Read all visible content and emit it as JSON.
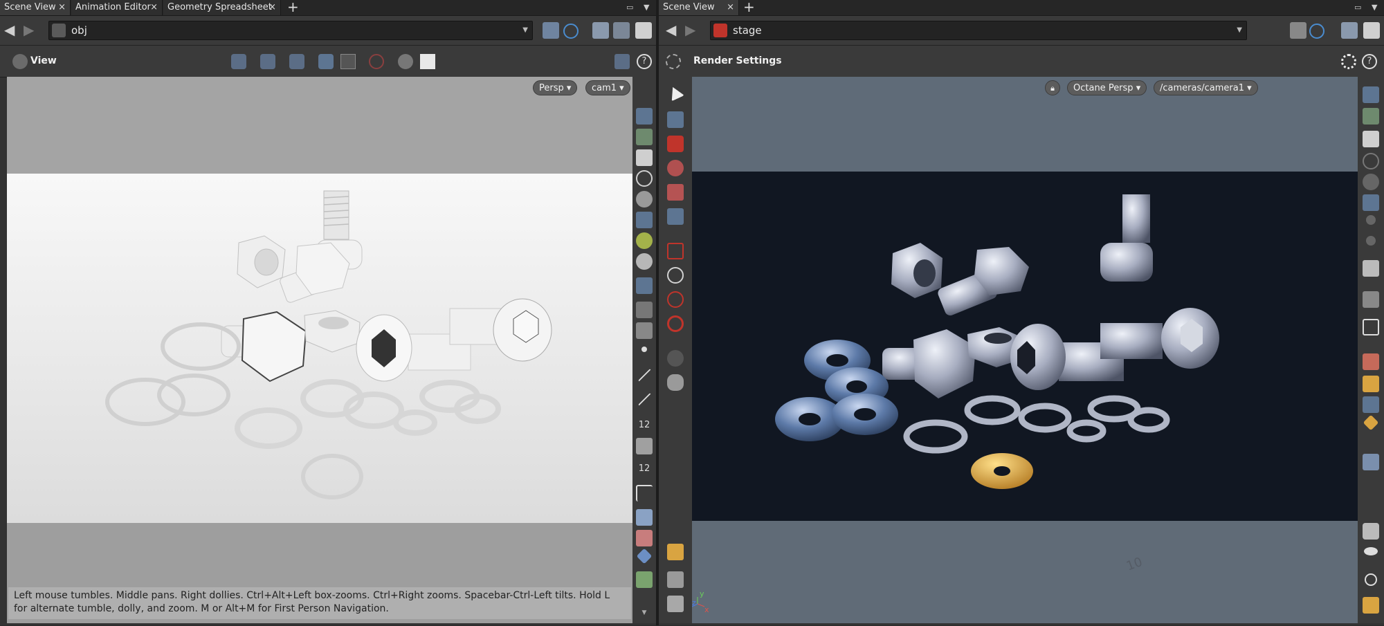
{
  "left_pane": {
    "tabs": [
      {
        "label": "Scene View",
        "close": "×"
      },
      {
        "label": "Animation Editor",
        "close": "×"
      },
      {
        "label": "Geometry Spreadsheet",
        "close": "×"
      }
    ],
    "add_tab": "+",
    "path": "obj",
    "toolbar_title": "View",
    "viewport_pills": {
      "camera_view": "Persp ▾",
      "camera": "cam1 ▾"
    },
    "status_message": "Left mouse tumbles. Middle pans. Right dollies. Ctrl+Alt+Left box-zooms. Ctrl+Right zooms. Spacebar-Ctrl-Left tilts. Hold L for alternate tumble, dolly, and zoom.     M or Alt+M for First Person Navigation.",
    "side_labels": {
      "point_size_a": "12",
      "point_size_b": "12"
    }
  },
  "right_pane": {
    "tabs": [
      {
        "label": "Scene View",
        "close": "×"
      }
    ],
    "add_tab": "+",
    "path": "stage",
    "toolbar_title": "Render Settings",
    "viewport_pills": {
      "renderer": "Octane Persp ▾",
      "camera_path": "/cameras/camera1 ▾"
    },
    "ground_label": "10",
    "axis": {
      "x": "x",
      "y": "y",
      "z": "z"
    }
  },
  "colors": {
    "accent_blue": "#5d7592",
    "render_gold": "#d9a441",
    "icon_red": "#c0342b"
  },
  "icons": {
    "back": "arrow-left-icon",
    "forward": "arrow-right-icon",
    "help": "help-icon",
    "gear": "gear-icon",
    "lock": "lock-icon",
    "magnet": "magnet-icon"
  }
}
